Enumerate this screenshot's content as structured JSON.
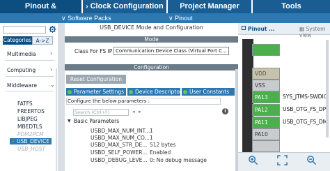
{
  "tabs": [
    {
      "label": "Pinout & Configuration",
      "active": true
    },
    {
      "label": "Clock Configuration",
      "active": false
    },
    {
      "label": "Project Manager",
      "active": false
    },
    {
      "label": "Tools",
      "active": false
    }
  ],
  "subbar": {
    "software_packs": "Software Packs",
    "pinout": "Pinout"
  },
  "left": {
    "subtab_categories": "Categories",
    "subtab_az": "A->Z",
    "categories": [
      "Multimedia",
      "Computing",
      "Middleware"
    ],
    "middleware_items": [
      {
        "label": "FATFS",
        "state": "normal"
      },
      {
        "label": "FREERTOS",
        "state": "normal"
      },
      {
        "label": "LIBJPEG",
        "state": "normal"
      },
      {
        "label": "MBEDTLS",
        "state": "normal"
      },
      {
        "label": "PDM2PCM",
        "state": "disabled"
      },
      {
        "label": "USB_DEVICE",
        "state": "selected"
      },
      {
        "label": "USB_HOST",
        "state": "disabled"
      }
    ]
  },
  "mid": {
    "title": "USB_DEVICE Mode and Configuration",
    "mode_bar": "Mode",
    "class_label": "Class For FS IP",
    "class_value": "Communication Device Class (Virtual Port C...",
    "config_bar": "Configuration",
    "reset_button": "Reset Configuration",
    "config_tabs": [
      "Parameter Settings",
      "Device Descriptor",
      "User Constants"
    ],
    "hint": "Configure the below parameters :",
    "search_placeholder": "Search (Ctrl+F)",
    "info_icon_label": "i",
    "group": "Basic Parameters",
    "params": [
      {
        "name": "USBD_MAX_NUM_INT...",
        "value": "1"
      },
      {
        "name": "USBD_MAX_NUM_CO...",
        "value": "1"
      },
      {
        "name": "USBD_MAX_STR_DE...",
        "value": "512 bytes"
      },
      {
        "name": "USBD_SELF_POWER...",
        "value": "Enabled"
      },
      {
        "name": "USBD_DEBUG_LEVE...",
        "value": "0: No debug message"
      }
    ]
  },
  "right": {
    "tab_pinout": "Pinout ...",
    "tab_system": "System view",
    "pins": [
      {
        "name": "",
        "label": "",
        "style": "green"
      },
      {
        "name": "VDD",
        "label": "",
        "style": "tan"
      },
      {
        "name": "VSS",
        "label": "",
        "style": "gray"
      },
      {
        "name": "PA13",
        "label": "SYS_JTMS-SWDIO",
        "style": "green"
      },
      {
        "name": "PA12",
        "label": "USB_OTG_FS_DP",
        "style": "green"
      },
      {
        "name": "PA11",
        "label": "USB_OTG_FS_DM",
        "style": "green"
      },
      {
        "name": "PA10",
        "label": "",
        "style": "gray"
      },
      {
        "name": "",
        "label": "",
        "style": "gray"
      }
    ]
  },
  "colors": {
    "tab_bg": "#0d4e80",
    "subbar_bg": "#2b78b3",
    "pin_green": "#4bb04b",
    "selected": "#2b78b3"
  }
}
